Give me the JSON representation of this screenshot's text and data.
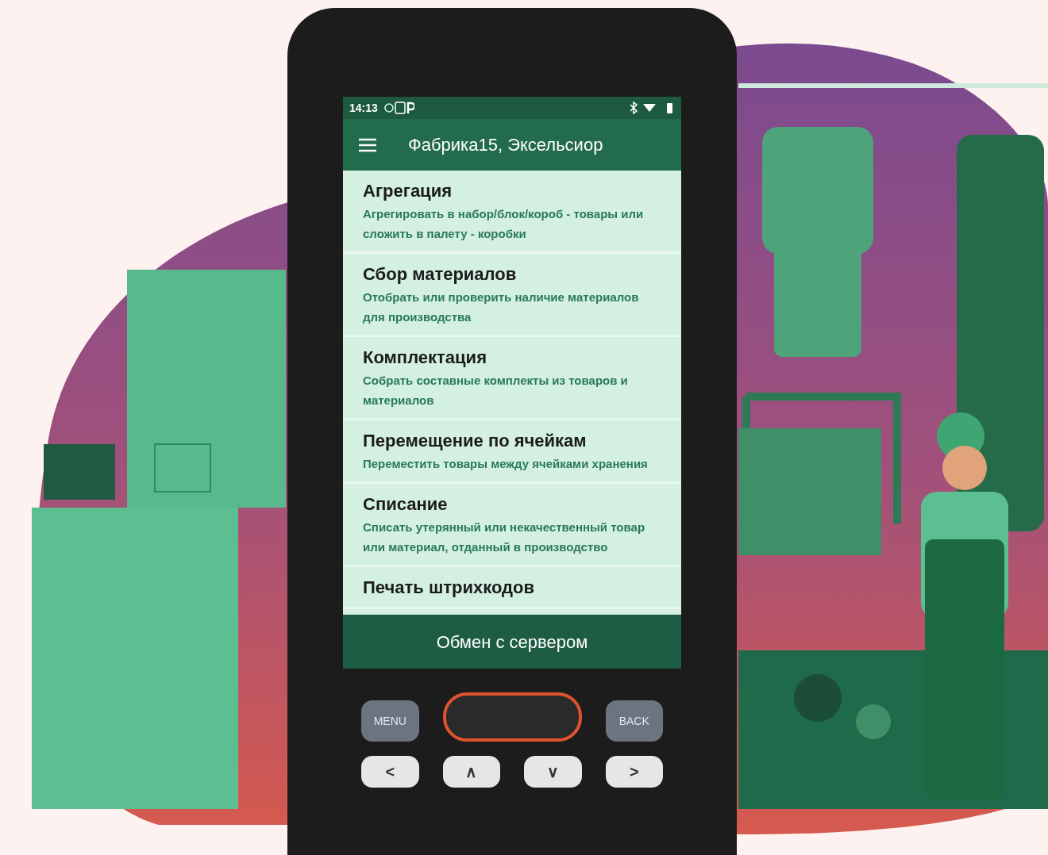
{
  "status_bar": {
    "time": "14:13"
  },
  "app_bar": {
    "title": "Фабрика15, Эксельсиор"
  },
  "menu_items": [
    {
      "title": "Агрегация",
      "description": "Агрегировать в набор/блок/короб - товары или сложить в палету - коробки"
    },
    {
      "title": "Сбор материалов",
      "description": "Отобрать или проверить наличие материалов для производства"
    },
    {
      "title": "Комплектация",
      "description": "Собрать составные комплекты из товаров и материалов"
    },
    {
      "title": "Перемещение по ячейкам",
      "description": "Переместить товары между ячейками хранения"
    },
    {
      "title": "Списание",
      "description": "Списать утерянный или некачественный товар или материал, отданный в производство"
    },
    {
      "title": "Печать штрихкодов"
    }
  ],
  "bottom_button": {
    "label": "Обмен с сервером"
  },
  "keys": [
    {
      "label": "MENU"
    },
    {
      "label": "BACK"
    },
    {
      "label": "<"
    },
    {
      "label": "∧"
    },
    {
      "label": "∨"
    },
    {
      "label": ">"
    }
  ]
}
